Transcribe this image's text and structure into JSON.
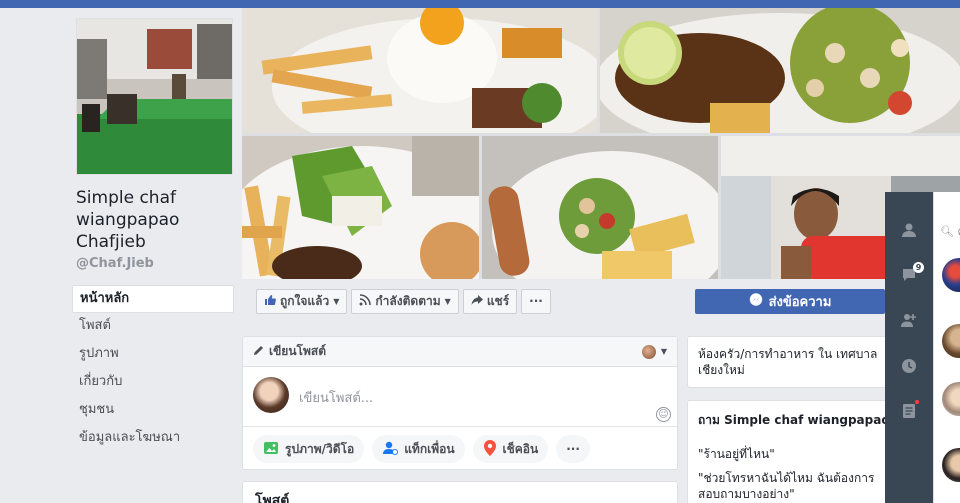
{
  "page": {
    "name": "Simple chaf wiangpapao Chafjieb",
    "handle": "@Chaf.Jieb"
  },
  "leftnav": {
    "items": [
      {
        "label": "หน้าหลัก"
      },
      {
        "label": "โพสต์"
      },
      {
        "label": "รูปภาพ"
      },
      {
        "label": "เกี่ยวกับ"
      },
      {
        "label": "ชุมชน"
      },
      {
        "label": "ข้อมูลและโฆษณา"
      }
    ]
  },
  "actions": {
    "like": "ถูกใจแล้ว",
    "follow": "กำลังติดตาม",
    "share": "แชร์",
    "more": "···",
    "message": "ส่งข้อความ"
  },
  "composer": {
    "title": "เขียนโพสต์",
    "placeholder": "เขียนโพสต์...",
    "photo_video": "รูปภาพ/วิดีโอ",
    "tag_friends": "แท็กเพื่อน",
    "check_in": "เช็คอิน",
    "more": "···"
  },
  "posts_heading": "โพสต์",
  "about": {
    "line1": "ห้องครัว/การทำอาหาร ใน เทศบาล",
    "line2": "เชียงใหม่"
  },
  "ask": {
    "title": "ถาม Simple chaf wiangpapao C",
    "q1": "\"ร้านอยู่ที่ไหน\"",
    "q2_line1": "\"ช่วยโทรหาฉันได้ไหม ฉันต้องการ",
    "q2_line2": "สอบถามบางอย่าง\""
  },
  "chat": {
    "search_placeholder": "ค้",
    "message_badge": "9"
  },
  "icons": {
    "like": "thumbs-up-icon",
    "follow": "rss-icon",
    "share": "share-arrow-icon",
    "messenger": "messenger-icon",
    "pencil": "pencil-icon",
    "photo": "photo-icon",
    "tag": "tag-friend-icon",
    "checkin": "location-pin-icon",
    "emoji": "emoji-icon",
    "chat_contacts": "person-icon",
    "chat_messages": "chat-bubble-icon",
    "chat_add": "add-person-icon",
    "chat_recent": "clock-icon",
    "chat_notes": "note-icon"
  },
  "colors": {
    "brand_blue": "#4267b2",
    "background": "#e9ebee",
    "chat_sidebar": "#394654"
  }
}
